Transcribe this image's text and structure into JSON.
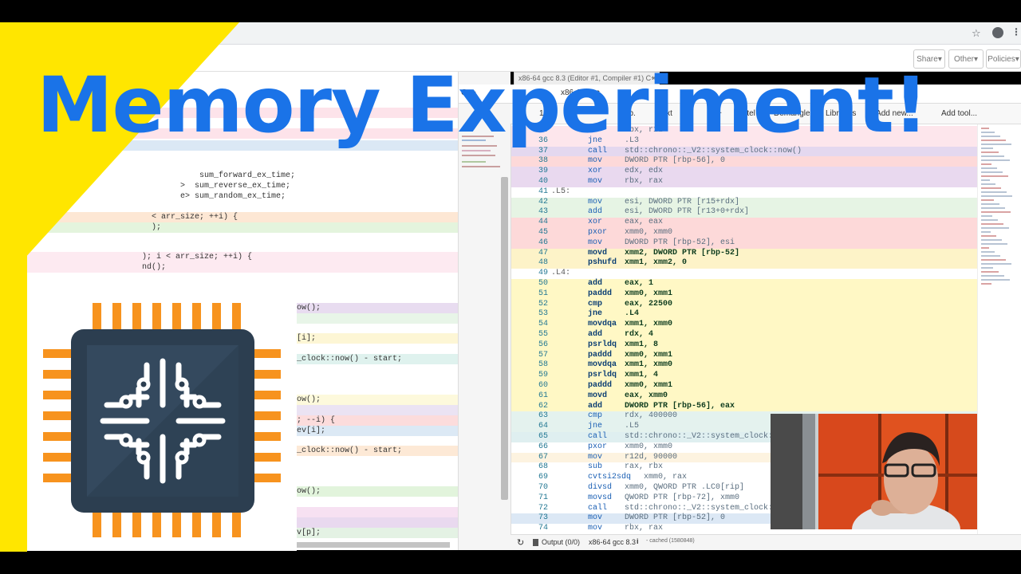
{
  "headline": "Memory Experiment!",
  "toolbar": {
    "share_label": "Share▾",
    "other_label": "Other▾",
    "policies_label": "Policies▾"
  },
  "compiler": {
    "tab_title": "x86-64 gcc 8.3 (Editor #1, Compiler #1) C++",
    "language": "C++",
    "compiler_name": "x86-64 gcc",
    "options": {
      "opt_11": "11",
      "lib": "lib.",
      "text": ".text",
      "comment": "//",
      "s": "s+",
      "intel": "Intel",
      "demangle": "Demangle",
      "libraries": "Libraries",
      "add_new": "+ Add new...",
      "add_tool": "Add tool..."
    }
  },
  "source_lines": [
    "    sum_forward_ex_time;",
    ">  sum_reverse_ex_time;",
    "e> sum_random_ex_time;",
    "  < arr_size; ++i) {",
    "  );",
    "); i < arr_size; ++i) {",
    "nd();",
    "ow();",
    "[i];",
    "_clock::now() - start;",
    "ow();",
    "; --i) {",
    "ev[i];",
    "_clock::now() - start;",
    "ow();",
    "v[p];"
  ],
  "asm_lines": [
    {
      "n": "35",
      "label": "",
      "op": "",
      "args": "rbx, r12"
    },
    {
      "n": "36",
      "label": "",
      "op": "jne",
      "args": ".L3"
    },
    {
      "n": "37",
      "label": "",
      "op": "call",
      "args": "std::chrono::_V2::system_clock::now()"
    },
    {
      "n": "38",
      "label": "",
      "op": "mov",
      "args": "DWORD PTR [rbp-56], 0"
    },
    {
      "n": "39",
      "label": "",
      "op": "xor",
      "args": "edx, edx"
    },
    {
      "n": "40",
      "label": "",
      "op": "mov",
      "args": "rbx, rax"
    },
    {
      "n": "41",
      "label": ".L5:",
      "op": "",
      "args": ""
    },
    {
      "n": "42",
      "label": "",
      "op": "mov",
      "args": "esi, DWORD PTR [r15+rdx]"
    },
    {
      "n": "43",
      "label": "",
      "op": "add",
      "args": "esi, DWORD PTR [r13+0+rdx]"
    },
    {
      "n": "44",
      "label": "",
      "op": "xor",
      "args": "eax, eax"
    },
    {
      "n": "45",
      "label": "",
      "op": "pxor",
      "args": "xmm0, xmm0"
    },
    {
      "n": "46",
      "label": "",
      "op": "mov",
      "args": "DWORD PTR [rbp-52], esi"
    },
    {
      "n": "47",
      "label": "",
      "op": "movd",
      "args": "xmm2, DWORD PTR [rbp-52]"
    },
    {
      "n": "48",
      "label": "",
      "op": "pshufd",
      "args": "xmm1, xmm2, 0"
    },
    {
      "n": "49",
      "label": ".L4:",
      "op": "",
      "args": ""
    },
    {
      "n": "50",
      "label": "",
      "op": "add",
      "args": "eax, 1"
    },
    {
      "n": "51",
      "label": "",
      "op": "paddd",
      "args": "xmm0, xmm1"
    },
    {
      "n": "52",
      "label": "",
      "op": "cmp",
      "args": "eax, 22500"
    },
    {
      "n": "53",
      "label": "",
      "op": "jne",
      "args": ".L4"
    },
    {
      "n": "54",
      "label": "",
      "op": "movdqa",
      "args": "xmm1, xmm0"
    },
    {
      "n": "55",
      "label": "",
      "op": "add",
      "args": "rdx, 4"
    },
    {
      "n": "56",
      "label": "",
      "op": "psrldq",
      "args": "xmm1, 8"
    },
    {
      "n": "57",
      "label": "",
      "op": "paddd",
      "args": "xmm0, xmm1"
    },
    {
      "n": "58",
      "label": "",
      "op": "movdqa",
      "args": "xmm1, xmm0"
    },
    {
      "n": "59",
      "label": "",
      "op": "psrldq",
      "args": "xmm1, 4"
    },
    {
      "n": "60",
      "label": "",
      "op": "paddd",
      "args": "xmm0, xmm1"
    },
    {
      "n": "61",
      "label": "",
      "op": "movd",
      "args": "eax, xmm0"
    },
    {
      "n": "62",
      "label": "",
      "op": "add",
      "args": "DWORD PTR [rbp-56], eax"
    },
    {
      "n": "63",
      "label": "",
      "op": "cmp",
      "args": "rdx, 400000"
    },
    {
      "n": "64",
      "label": "",
      "op": "jne",
      "args": ".L5"
    },
    {
      "n": "65",
      "label": "",
      "op": "call",
      "args": "std::chrono::_V2::system_clock::n"
    },
    {
      "n": "66",
      "label": "",
      "op": "pxor",
      "args": "xmm0, xmm0"
    },
    {
      "n": "67",
      "label": "",
      "op": "mov",
      "args": "r12d, 90000"
    },
    {
      "n": "68",
      "label": "",
      "op": "sub",
      "args": "rax, rbx"
    },
    {
      "n": "69",
      "label": "",
      "op": "cvtsi2sdq",
      "args": "    xmm0, rax"
    },
    {
      "n": "70",
      "label": "",
      "op": "divsd",
      "args": "xmm0, QWORD PTR .LC0[rip]"
    },
    {
      "n": "71",
      "label": "",
      "op": "movsd",
      "args": "QWORD PTR [rbp-72], xmm0"
    },
    {
      "n": "72",
      "label": "",
      "op": "call",
      "args": "std::chrono::_V2::system_clock::n"
    },
    {
      "n": "73",
      "label": "",
      "op": "mov",
      "args": "DWORD PTR [rbp-52], 0"
    },
    {
      "n": "74",
      "label": "",
      "op": "mov",
      "args": "rbx, rax"
    }
  ],
  "status": {
    "output": "Output (0/0)",
    "compiler": "x86-64 gcc 8.3",
    "info": "i",
    "cached": "- cached (1580848)"
  },
  "colors": {
    "headline": "#1a73e8",
    "yellow": "#ffe600",
    "chip_orange": "#f7931e",
    "chip_body": "#2c3e50",
    "asm_yellow": "#fff8c5"
  },
  "icons": [
    "star-icon",
    "account-icon",
    "menu-icon",
    "chip-icon",
    "refresh-icon",
    "output-icon",
    "info-icon"
  ]
}
